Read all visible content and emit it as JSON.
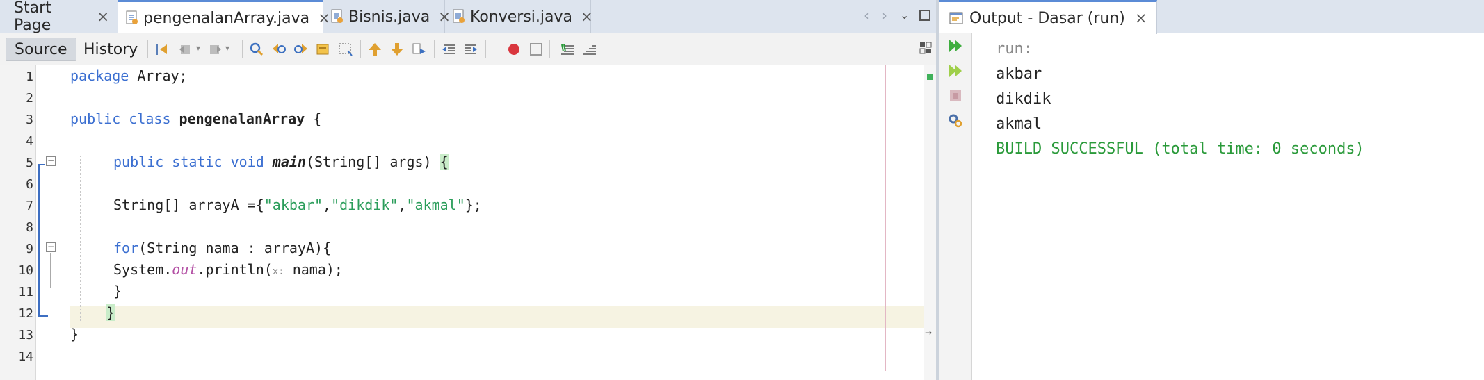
{
  "editor": {
    "tabs": [
      {
        "label": "Start Page",
        "active": false
      },
      {
        "label": "pengenalanArray.java",
        "active": true
      },
      {
        "label": "Bisnis.java",
        "active": false
      },
      {
        "label": "Konversi.java",
        "active": false
      }
    ],
    "close_glyph": "×",
    "toolbar": {
      "source_label": "Source",
      "history_label": "History"
    },
    "line_numbers": [
      "1",
      "2",
      "3",
      "4",
      "5",
      "6",
      "7",
      "8",
      "9",
      "10",
      "11",
      "12",
      "13",
      "14"
    ],
    "code": {
      "l1": {
        "kw": "package",
        "rest": " Array;"
      },
      "l3": {
        "kw": "public class",
        "name": "pengenalanArray",
        "rest": " {"
      },
      "l5": {
        "kw": "public static void",
        "name": "main",
        "rest": "(String[] args) ",
        "brace": "{"
      },
      "l7": {
        "pre": "String[] arrayA ={",
        "s1": "\"akbar\"",
        "c1": ",",
        "s2": "\"dikdik\"",
        "c2": ",",
        "s3": "\"akmal\"",
        "post": "};"
      },
      "l9": {
        "kw": "for",
        "rest": "(String nama : arrayA){"
      },
      "l10": {
        "pre": "System.",
        "field": "out",
        "mid": ".println(",
        "hint": "x:",
        "post": " nama);"
      },
      "l11": {
        "text": "}"
      },
      "l12": {
        "text": "}"
      },
      "l13": {
        "text": "}"
      }
    }
  },
  "output": {
    "title": "Output - Dasar (run)",
    "close_glyph": "×",
    "lines": {
      "run": "run:",
      "out1": "akbar",
      "out2": "dikdik",
      "out3": "akmal",
      "build": "BUILD SUCCESSFUL (total time: 0 seconds)"
    }
  },
  "colors": {
    "keyword": "#3b6fd1",
    "string": "#2a9d5a",
    "success": "#2a9a3a",
    "active_tab_accent": "#5b8bd6"
  }
}
